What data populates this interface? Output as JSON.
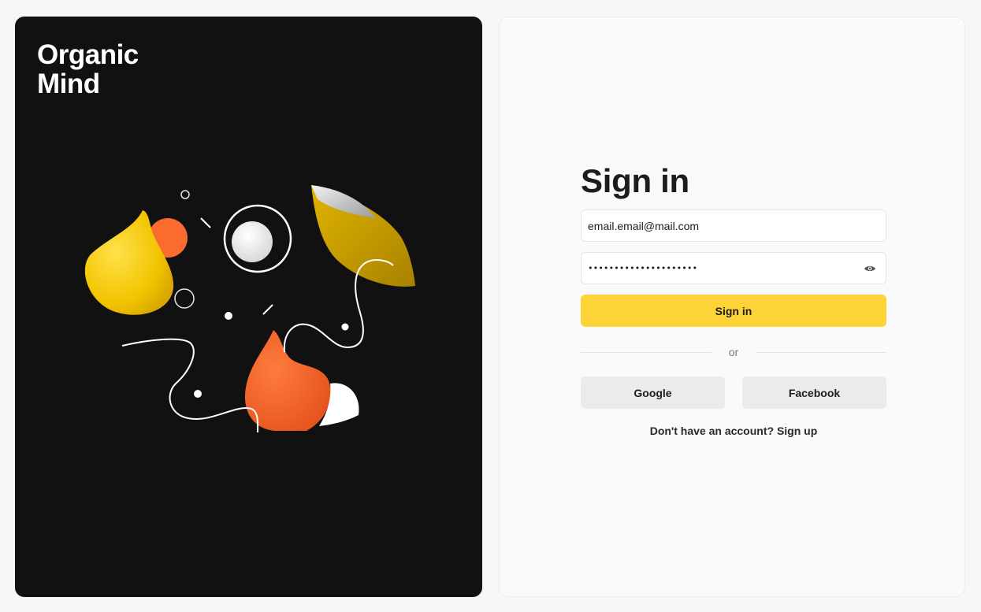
{
  "brand": {
    "line1": "Organic",
    "line2": "Mind"
  },
  "signin": {
    "title": "Sign in",
    "email_value": "email.email@mail.com",
    "password_value": "•••••••••••••••••••••",
    "password_toggle_icon": "eye-icon",
    "submit_label": "Sign in",
    "divider_text": "or",
    "google_label": "Google",
    "facebook_label": "Facebook",
    "signup_prompt": "Don't have an account?",
    "signup_link": "Sign up"
  },
  "colors": {
    "accent_yellow": "#fdd337",
    "art_background": "#111111",
    "shape_orange": "#fb6a2f",
    "shape_yellow": "#f7c800",
    "social_button": "#ebebeb"
  }
}
